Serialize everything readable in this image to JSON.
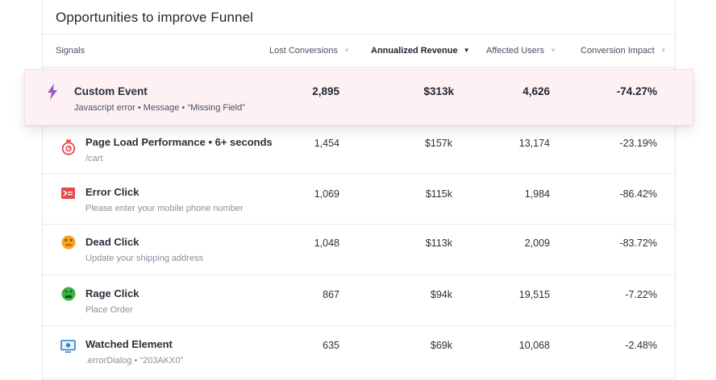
{
  "title": "Opportunities to improve Funnel",
  "headers": {
    "signals": "Signals",
    "lost": "Lost Conversions",
    "revenue": "Annualized Revenue",
    "users": "Affected Users",
    "impact": "Conversion Impact"
  },
  "sort": {
    "column": "Annualized Revenue",
    "direction": "descending"
  },
  "colors": {
    "highlight_bg": "#fdf1f4",
    "custom_event_icon": "#9b59d0",
    "timer_icon": "#e5484d",
    "error_icon": "#e5484d",
    "dead_icon": "#f5a524",
    "rage_icon": "#3cb043",
    "watched_icon": "#2f80c7"
  },
  "rows": [
    {
      "icon": "lightning-icon",
      "name": "Custom Event",
      "detail": "Javascript error • Message • “Missing Field”",
      "lost": "2,895",
      "revenue": "$313k",
      "users": "4,626",
      "impact": "-74.27%"
    },
    {
      "icon": "timer-icon",
      "name": "Page Load Performance • 6+ seconds",
      "detail": "/cart",
      "lost": "1,454",
      "revenue": "$157k",
      "users": "13,174",
      "impact": "-23.19%"
    },
    {
      "icon": "error-terminal-icon",
      "name": "Error Click",
      "detail": "Please enter your mobile phone number",
      "lost": "1,069",
      "revenue": "$115k",
      "users": "1,984",
      "impact": "-86.42%"
    },
    {
      "icon": "dead-face-icon",
      "name": "Dead Click",
      "detail": "Update your shipping address",
      "lost": "1,048",
      "revenue": "$113k",
      "users": "2,009",
      "impact": "-83.72%"
    },
    {
      "icon": "rage-face-icon",
      "name": "Rage Click",
      "detail": "Place Order",
      "lost": "867",
      "revenue": "$94k",
      "users": "19,515",
      "impact": "-7.22%"
    },
    {
      "icon": "monitor-eye-icon",
      "name": "Watched Element",
      "detail": ".errorDialog • “203AKX0”",
      "lost": "635",
      "revenue": "$69k",
      "users": "10,068",
      "impact": "-2.48%"
    }
  ]
}
